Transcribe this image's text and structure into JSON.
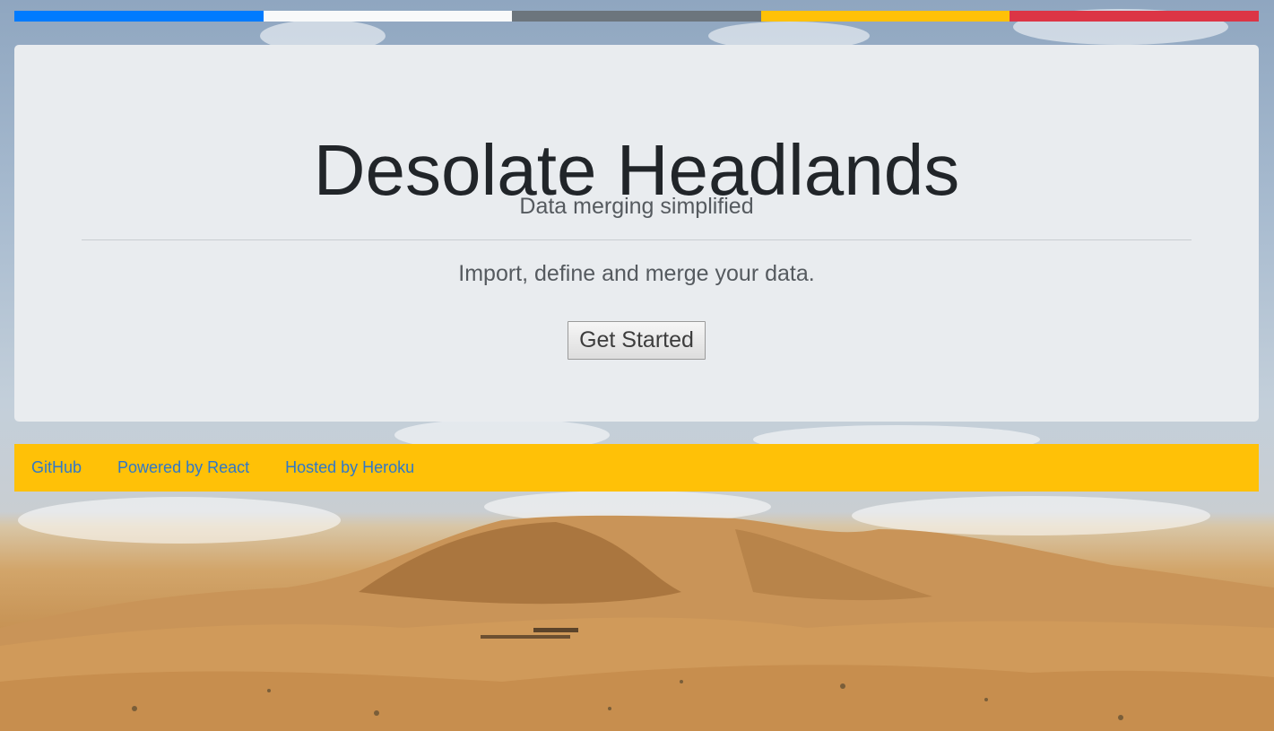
{
  "colors": {
    "strip": [
      "#007bff",
      "#f8f9fa",
      "#6c757d",
      "#ffc107",
      "#dc3545"
    ],
    "footer_bg": "#ffc107",
    "jumbotron_bg": "#e9ecef"
  },
  "jumbotron": {
    "title": "Desolate Headlands",
    "subtitle": "Data merging simplified",
    "description": "Import, define and merge your data.",
    "button_label": "Get Started"
  },
  "footer": {
    "links": [
      {
        "label": "GitHub"
      },
      {
        "label": "Powered by React"
      },
      {
        "label": "Hosted by Heroku"
      }
    ]
  },
  "background": {
    "image": "desert-dunes-with-camel-caravan"
  }
}
